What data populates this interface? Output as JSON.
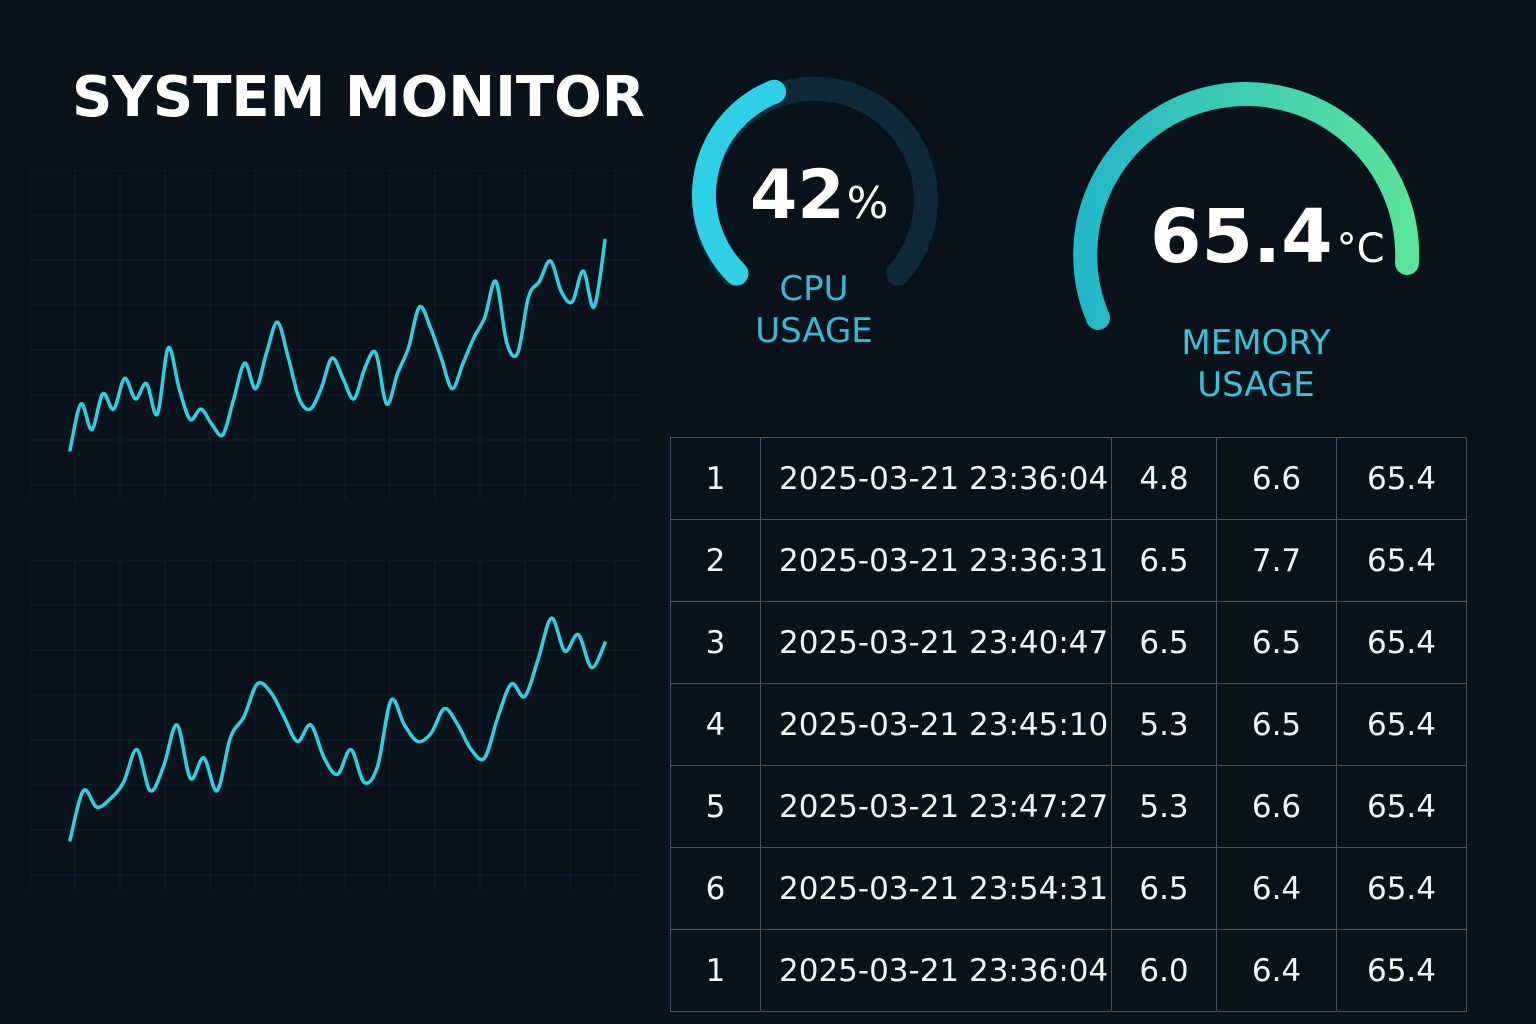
{
  "page": {
    "title": "SYSTEM MONITOR"
  },
  "cpu_gauge": {
    "value": "42",
    "unit": "%",
    "percent": 42,
    "label_line1": "CPU",
    "label_line2": "USAGE",
    "color": "#2ed0e6",
    "track_color": "#0e2a3a"
  },
  "temp_gauge": {
    "value": "65.4",
    "unit": "°C",
    "label_line1": "MEMORY",
    "label_line2": "USAGE",
    "gradient_start": "#22b8c8",
    "gradient_end": "#5ae39a"
  },
  "log_table": {
    "rows": [
      [
        "1",
        "2025-03-21  23:36:04",
        "4.8",
        "6.6",
        "65.4"
      ],
      [
        "2",
        "2025-03-21  23:36:31",
        "6.5",
        "7.7",
        "65.4"
      ],
      [
        "3",
        "2025-03-21  23:40:47",
        "6.5",
        "6.5",
        "65.4"
      ],
      [
        "4",
        "2025-03-21  23:45:10",
        "5.3",
        "6.5",
        "65.4"
      ],
      [
        "5",
        "2025-03-21  23:47:27",
        "5.3",
        "6.6",
        "65.4"
      ],
      [
        "6",
        "2025-03-21  23:54:31",
        "6.5",
        "6.4",
        "65.4"
      ],
      [
        "1",
        "2025-03-21  23:36:04",
        "6.0",
        "6.4",
        "65.4"
      ]
    ]
  },
  "chart_data": [
    {
      "type": "line",
      "title": "",
      "xlabel": "",
      "ylabel": "",
      "grid": true,
      "line_color": "#2ed0e6",
      "x": [
        0,
        1,
        2,
        3,
        4,
        5,
        6,
        7,
        8,
        9,
        10,
        11,
        12,
        13,
        14,
        15,
        16,
        17,
        18,
        19,
        20,
        21,
        22,
        23,
        24,
        25,
        26,
        27,
        28,
        29,
        30,
        31,
        32,
        33,
        34,
        35,
        36,
        37,
        38,
        39,
        40,
        41,
        42,
        43,
        44,
        45,
        46,
        47,
        48,
        49,
        50,
        51,
        52,
        53,
        54
      ],
      "values": [
        0,
        9,
        4,
        11,
        8,
        14,
        10,
        13,
        7,
        20,
        12,
        6,
        8,
        5,
        3,
        10,
        17,
        12,
        19,
        25,
        18,
        10,
        8,
        12,
        18,
        14,
        10,
        16,
        19,
        9,
        15,
        20,
        28,
        24,
        18,
        12,
        17,
        22,
        26,
        33,
        21,
        19,
        30,
        33,
        37,
        31,
        29,
        35,
        28,
        41
      ],
      "ylim": [
        0,
        45
      ]
    },
    {
      "type": "line",
      "title": "",
      "xlabel": "",
      "ylabel": "",
      "grid": true,
      "line_color": "#2ed0e6",
      "values": [
        0,
        12,
        8,
        10,
        14,
        22,
        12,
        18,
        28,
        15,
        20,
        12,
        25,
        30,
        38,
        36,
        30,
        24,
        28,
        20,
        16,
        22,
        14,
        18,
        34,
        28,
        24,
        26,
        32,
        28,
        22,
        20,
        30,
        38,
        35,
        44,
        54,
        46,
        50,
        42,
        48
      ],
      "ylim": [
        0,
        56
      ]
    }
  ]
}
